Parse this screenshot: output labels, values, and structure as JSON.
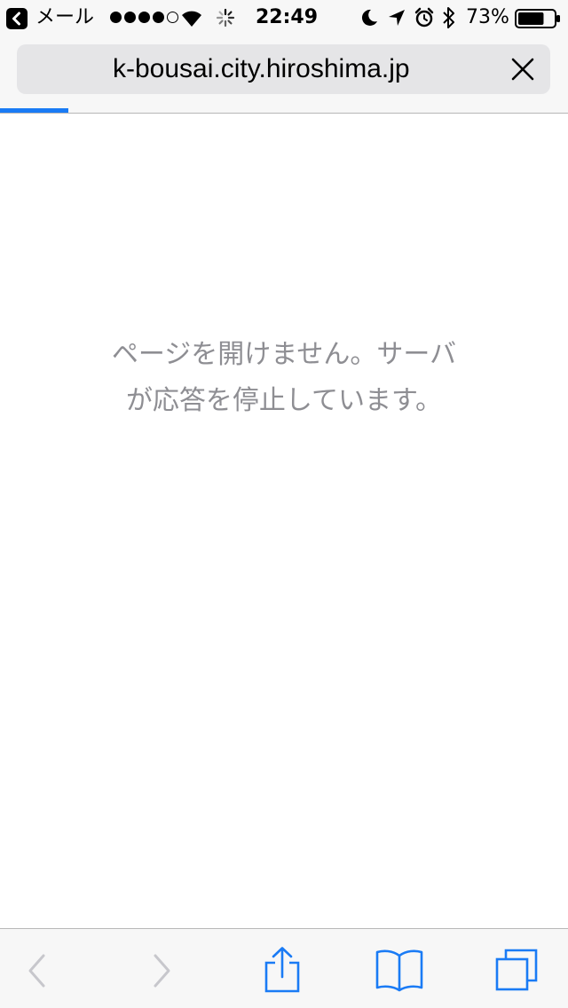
{
  "status_bar": {
    "back_app_label": "メール",
    "signal_dots_filled": 4,
    "signal_dots_total": 5,
    "time": "22:49",
    "battery_percent": "73%",
    "battery_level": 0.73
  },
  "browser": {
    "url": "k-bousai.city.hiroshima.jp",
    "load_progress": 0.12
  },
  "page": {
    "error_line_1": "ページを開けません。サーバ",
    "error_line_2": "が応答を停止しています。"
  },
  "toolbar": {
    "buttons": [
      "back-icon",
      "forward-icon",
      "share-icon",
      "bookmarks-icon",
      "tabs-icon"
    ]
  },
  "colors": {
    "accent": "#1a7bf5",
    "disabled": "#c7c7cc",
    "message_text": "#8e8e93",
    "bar_background": "#f7f7f7"
  }
}
